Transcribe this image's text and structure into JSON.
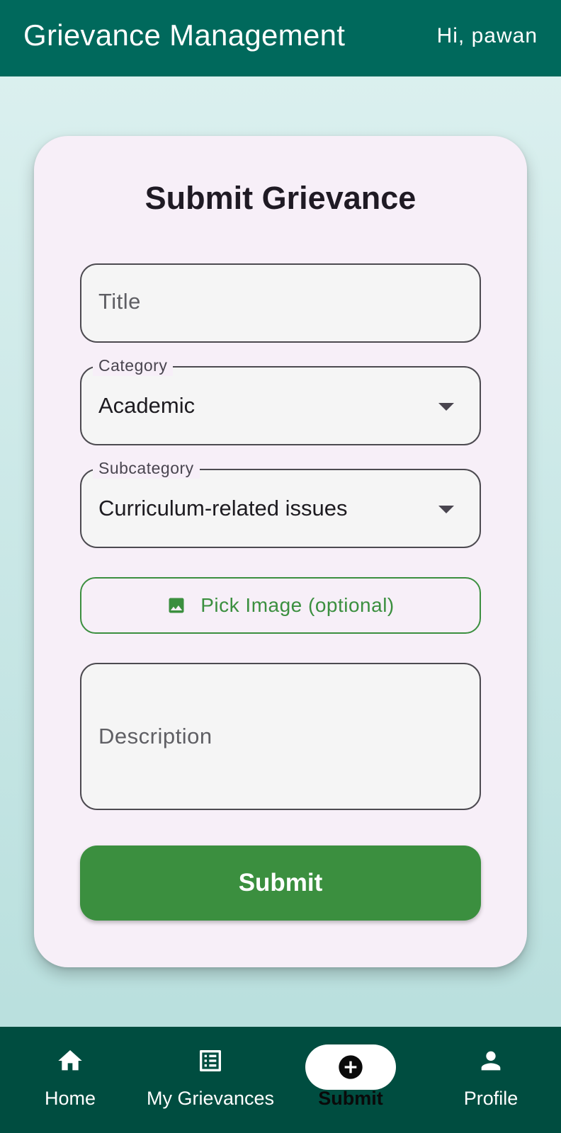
{
  "appbar": {
    "title": "Grievance Management",
    "greeting": "Hi, pawan"
  },
  "form": {
    "heading": "Submit Grievance",
    "title_placeholder": "Title",
    "category": {
      "label": "Category",
      "value": "Academic"
    },
    "subcategory": {
      "label": "Subcategory",
      "value": "Curriculum-related issues"
    },
    "pick_image_label": "Pick Image (optional)",
    "description_placeholder": "Description",
    "submit_label": "Submit"
  },
  "bottom_nav": {
    "items": [
      {
        "label": "Home",
        "icon": "home-icon"
      },
      {
        "label": "My Grievances",
        "icon": "list-icon"
      },
      {
        "label": "Submit",
        "icon": "add-circle-icon",
        "active": true
      },
      {
        "label": "Profile",
        "icon": "person-icon"
      }
    ]
  },
  "colors": {
    "appbar": "#00695c",
    "bottom_nav": "#004d40",
    "primary_green": "#3b8f3f",
    "card": "#f7eff8"
  }
}
